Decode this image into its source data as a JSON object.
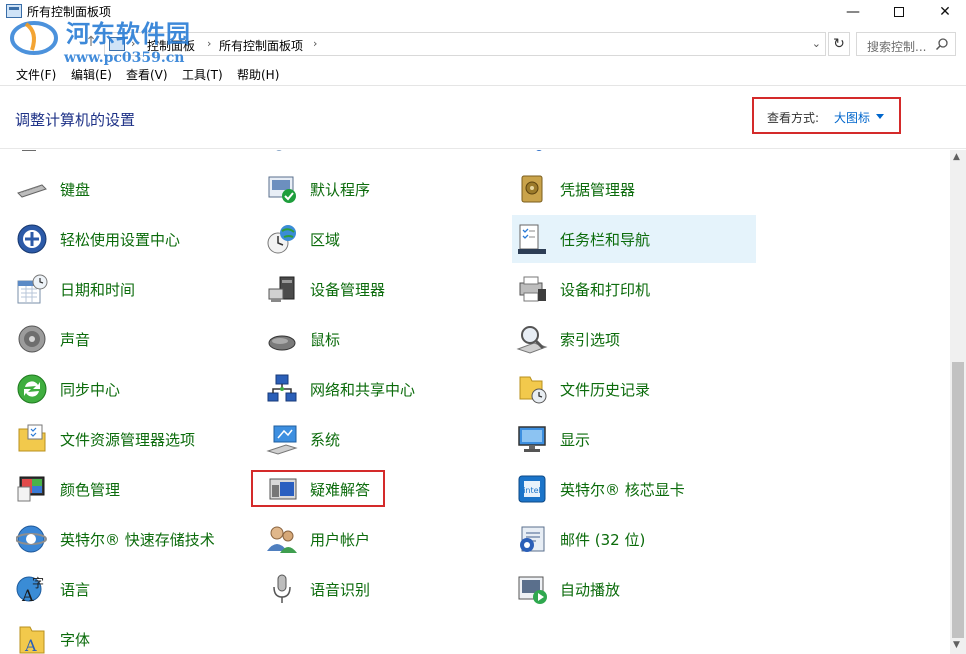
{
  "window": {
    "title": "所有控制面板项"
  },
  "watermark": {
    "title": "河东软件园",
    "url": "www.pc0359.cn"
  },
  "address": {
    "crumbs": [
      "控制面板",
      "所有控制面板项"
    ],
    "search_placeholder": "搜索控制..."
  },
  "menu": [
    "文件(F)",
    "编辑(E)",
    "查看(V)",
    "工具(T)",
    "帮助(H)"
  ],
  "header": {
    "heading": "调整计算机的设置",
    "view_by_label": "查看方式:",
    "view_by_value": "大图标"
  },
  "items": [
    {
      "label": "键盘",
      "icon": "keyboard-icon"
    },
    {
      "label": "默认程序",
      "icon": "default-programs-icon"
    },
    {
      "label": "凭据管理器",
      "icon": "credential-manager-icon"
    },
    {
      "label": "轻松使用设置中心",
      "icon": "ease-of-access-icon"
    },
    {
      "label": "区域",
      "icon": "region-icon"
    },
    {
      "label": "任务栏和导航",
      "icon": "taskbar-icon"
    },
    {
      "label": "日期和时间",
      "icon": "date-time-icon"
    },
    {
      "label": "设备管理器",
      "icon": "device-manager-icon"
    },
    {
      "label": "设备和打印机",
      "icon": "printer-icon"
    },
    {
      "label": "声音",
      "icon": "sound-icon"
    },
    {
      "label": "鼠标",
      "icon": "mouse-icon"
    },
    {
      "label": "索引选项",
      "icon": "indexing-icon"
    },
    {
      "label": "同步中心",
      "icon": "sync-center-icon"
    },
    {
      "label": "网络和共享中心",
      "icon": "network-icon"
    },
    {
      "label": "文件历史记录",
      "icon": "file-history-icon"
    },
    {
      "label": "文件资源管理器选项",
      "icon": "folder-options-icon"
    },
    {
      "label": "系统",
      "icon": "system-icon"
    },
    {
      "label": "显示",
      "icon": "display-icon"
    },
    {
      "label": "颜色管理",
      "icon": "color-management-icon"
    },
    {
      "label": "疑难解答",
      "icon": "troubleshooting-icon"
    },
    {
      "label": "英特尔® 核芯显卡",
      "icon": "intel-graphics-icon"
    },
    {
      "label": "英特尔® 快速存储技术",
      "icon": "intel-rst-icon"
    },
    {
      "label": "用户帐户",
      "icon": "user-accounts-icon"
    },
    {
      "label": "邮件 (32 位)",
      "icon": "mail-icon"
    },
    {
      "label": "语言",
      "icon": "language-icon"
    },
    {
      "label": "语音识别",
      "icon": "speech-recognition-icon"
    },
    {
      "label": "自动播放",
      "icon": "autoplay-icon"
    },
    {
      "label": "字体",
      "icon": "fonts-icon"
    }
  ],
  "colors": {
    "link_green": "#0b6b0b",
    "heading_blue": "#1e3287",
    "highlight_red": "#d42a2a",
    "hover_bg": "#e5f3fb"
  }
}
